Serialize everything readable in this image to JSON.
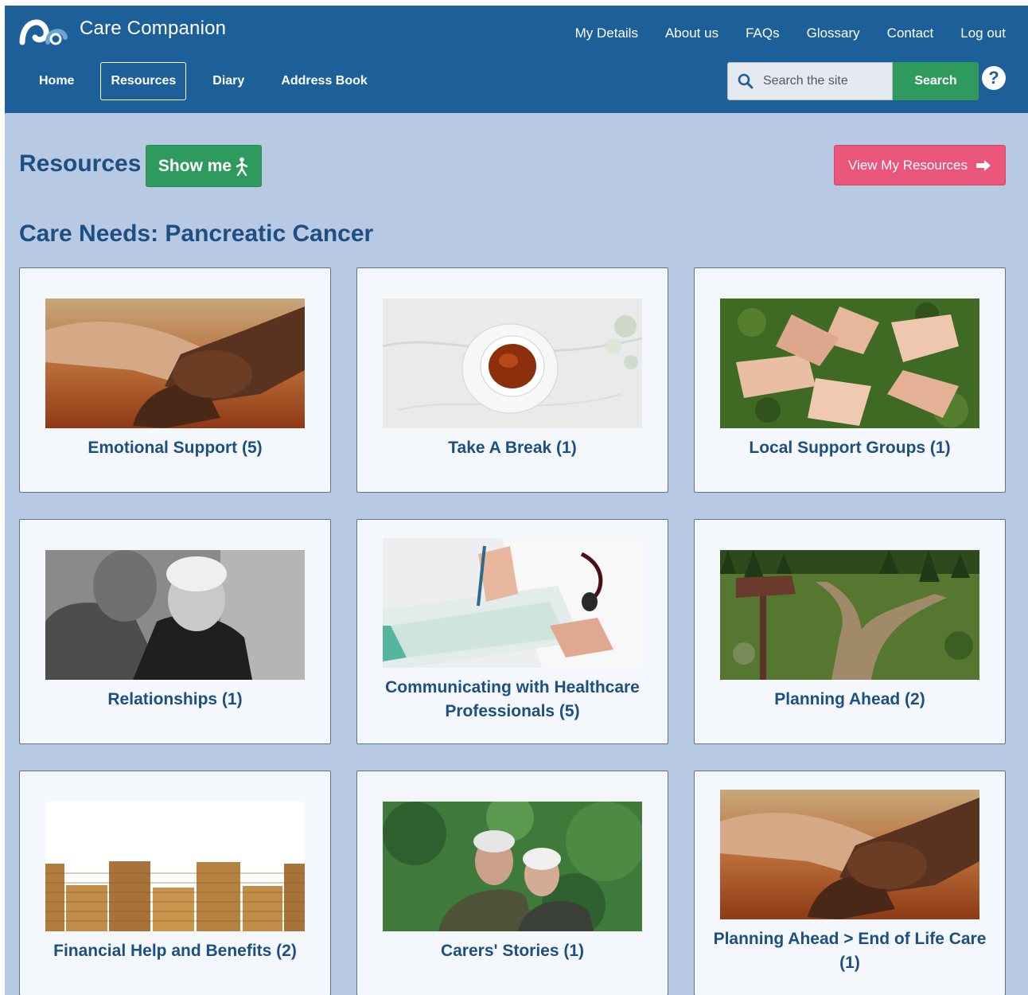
{
  "brand": {
    "name": "Care Companion"
  },
  "top_nav": [
    "My Details",
    "About us",
    "FAQs",
    "Glossary",
    "Contact",
    "Log out"
  ],
  "main_nav": [
    {
      "label": "Home",
      "active": false
    },
    {
      "label": "Resources",
      "active": true
    },
    {
      "label": "Diary",
      "active": false
    },
    {
      "label": "Address Book",
      "active": false
    }
  ],
  "search": {
    "placeholder": "Search the site",
    "button": "Search"
  },
  "help": {
    "symbol": "?"
  },
  "page": {
    "title": "Resources",
    "show_me": "Show me",
    "view_resources": "View My Resources",
    "section_title": "Care Needs: Pancreatic Cancer"
  },
  "cards": [
    {
      "label": "Emotional Support (5)",
      "image": "holding-hands-photo"
    },
    {
      "label": "Take A Break (1)",
      "image": "tea-cup-photo"
    },
    {
      "label": "Local Support Groups (1)",
      "image": "linked-hands-photo"
    },
    {
      "label": "Relationships (1)",
      "image": "older-couple-bw-photo"
    },
    {
      "label": "Communicating with Healthcare Professionals (5)",
      "image": "doctor-clipboard-photo"
    },
    {
      "label": "Planning Ahead (2)",
      "image": "forked-path-photo"
    },
    {
      "label": "Financial Help and Benefits (2)",
      "image": "coin-stacks-photo"
    },
    {
      "label": "Carers' Stories (1)",
      "image": "older-couple-outdoors-photo"
    },
    {
      "label": "Planning Ahead > End of Life Care (1)",
      "image": "holding-hands-photo"
    }
  ],
  "colors": {
    "header": "#1d5f98",
    "page_bg": "#b8c9e4",
    "green": "#2f9a5e",
    "pink": "#e9567a",
    "heading": "#1d4f82"
  }
}
